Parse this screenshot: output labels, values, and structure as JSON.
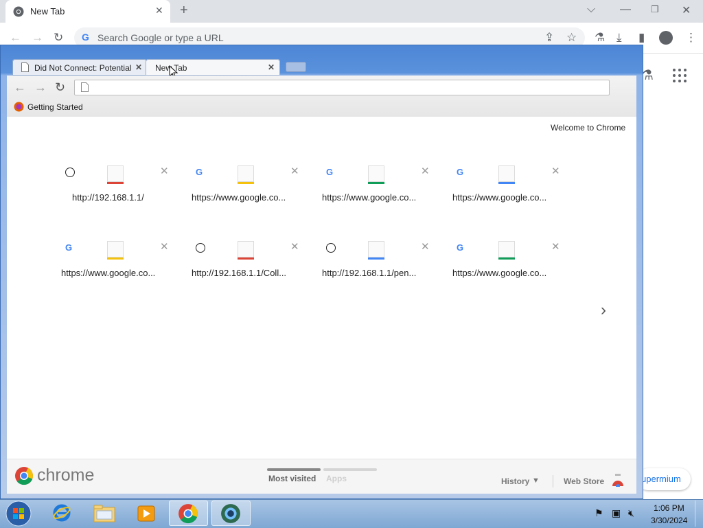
{
  "outer_browser": {
    "tab_title": "New Tab",
    "omnibox_placeholder": "Search Google or type a URL",
    "chip_text": "upermium"
  },
  "old_browser": {
    "tabs": [
      {
        "title": "Did Not Connect: Potential"
      },
      {
        "title": "New Tab"
      }
    ],
    "omnibox_value": "",
    "bookmarks": [
      {
        "label": "Getting Started"
      }
    ],
    "welcome_link": "Welcome to Chrome",
    "tiles": [
      {
        "label": "http://192.168.1.1/",
        "favicon": "globe-icon",
        "accent": "#db4437"
      },
      {
        "label": "https://www.google.co...",
        "favicon": "google-g-icon",
        "accent": "#f4c20d"
      },
      {
        "label": "https://www.google.co...",
        "favicon": "google-g-icon",
        "accent": "#0f9d58"
      },
      {
        "label": "https://www.google.co...",
        "favicon": "google-g-icon",
        "accent": "#4285f4"
      },
      {
        "label": "https://www.google.co...",
        "favicon": "google-g-icon",
        "accent": "#f4c20d"
      },
      {
        "label": "http://192.168.1.1/Coll...",
        "favicon": "globe-icon",
        "accent": "#db4437"
      },
      {
        "label": "http://192.168.1.1/pen...",
        "favicon": "globe-icon",
        "accent": "#4285f4"
      },
      {
        "label": "https://www.google.co...",
        "favicon": "google-g-icon",
        "accent": "#0f9d58"
      }
    ],
    "footer": {
      "logo_text": "chrome",
      "sections": [
        {
          "label": "Most visited",
          "selected": true
        },
        {
          "label": "Apps",
          "selected": false
        }
      ],
      "history_label": "History",
      "web_store_label": "Web Store"
    }
  },
  "taskbar": {
    "time": "1:06 PM",
    "date": "3/30/2024"
  }
}
